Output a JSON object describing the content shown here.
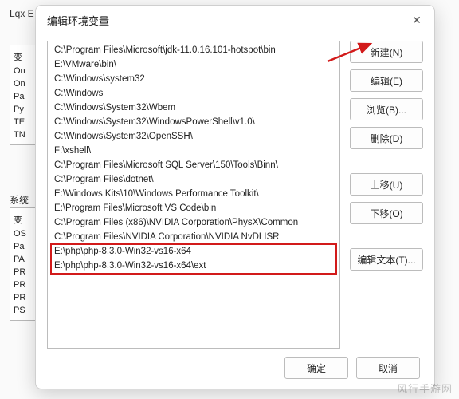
{
  "bg": {
    "corner_label": "Lqx E",
    "section2_label": "系统",
    "col1": [
      "变",
      "On",
      "On",
      "Pa",
      "Py",
      "TE",
      "TN"
    ],
    "col2": [
      "变",
      "OS",
      "Pa",
      "PA",
      "PR",
      "PR",
      "PR",
      "PS"
    ]
  },
  "dialog": {
    "title": "编辑环境变量",
    "close_glyph": "✕",
    "paths": [
      "C:\\Program Files\\Microsoft\\jdk-11.0.16.101-hotspot\\bin",
      "E:\\VMware\\bin\\",
      "C:\\Windows\\system32",
      "C:\\Windows",
      "C:\\Windows\\System32\\Wbem",
      "C:\\Windows\\System32\\WindowsPowerShell\\v1.0\\",
      "C:\\Windows\\System32\\OpenSSH\\",
      "F:\\xshell\\",
      "C:\\Program Files\\Microsoft SQL Server\\150\\Tools\\Binn\\",
      "C:\\Program Files\\dotnet\\",
      "E:\\Windows Kits\\10\\Windows Performance Toolkit\\",
      "E:\\Program Files\\Microsoft VS Code\\bin",
      "C:\\Program Files (x86)\\NVIDIA Corporation\\PhysX\\Common",
      "C:\\Program Files\\NVIDIA Corporation\\NVIDIA NvDLISR",
      "E:\\php\\php-8.3.0-Win32-vs16-x64",
      "E:\\php\\php-8.3.0-Win32-vs16-x64\\ext"
    ],
    "buttons": {
      "new": "新建(N)",
      "edit": "编辑(E)",
      "browse": "浏览(B)...",
      "delete": "删除(D)",
      "move_up": "上移(U)",
      "move_down": "下移(O)",
      "edit_text": "编辑文本(T)...",
      "ok": "确定",
      "cancel": "取消"
    }
  },
  "watermark": "风行手游网"
}
